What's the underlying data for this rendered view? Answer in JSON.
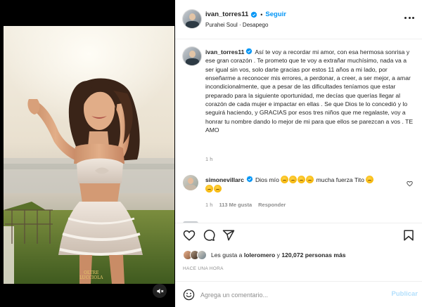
{
  "post": {
    "username": "ivan_torres11",
    "follow_label": "Seguir",
    "audio": "Purahei Soul · Desapego",
    "caption": "Así te voy a recordar mi amor, con esa hermosa sonrisa y ese gran corazón . Te prometo que te voy a extrañar muchísimo, nada va a ser igual sin vos, solo darte gracias por estos 11 años a mi lado, por enseñarme a reconocer mis errores, a perdonar, a creer, a ser mejor, a amar incondicionalmente, que a pesar de las dificultades teníamos que estar preparado para la siguiente oportunidad, me decías que querías llegar al corazón de cada mujer e impactar en ellas . Se que Dios te lo concedió y lo seguirá haciendo, y GRACIAS por esos tres niños que me regalaste, voy a honrar tu nombre dando lo mejor de mi para que ellos se parezcan a vos . TE AMO",
    "caption_time": "1 h"
  },
  "comments": [
    {
      "username": "simonevillarc",
      "text_before": "Dios mío",
      "text_after": "mucha fuerza Tito",
      "time": "1 h",
      "likes": "113 Me gusta",
      "reply_label": "Responder"
    }
  ],
  "likes": {
    "prefix": "Les gusta a",
    "user": "loleromero",
    "connector": "y",
    "others": "120,072 personas más"
  },
  "date": "HACE UNA HORA",
  "composer": {
    "placeholder": "Agrega un comentario...",
    "post_label": "Publicar"
  },
  "media": {
    "watermark_line1": "OLTRE",
    "watermark_line2": "LUCCIOLA"
  },
  "colors": {
    "accent": "#0095f6",
    "verified": "#0095f6",
    "post_disabled": "#b2dffc",
    "muted_text": "#8e8e8e"
  },
  "icons": {
    "verified": "verified-badge-icon",
    "more": "more-options-icon",
    "mute": "muted-speaker-icon",
    "like": "heart-icon",
    "comment": "comment-bubble-icon",
    "share": "paper-plane-icon",
    "save": "bookmark-icon",
    "emoji": "smiley-face-icon"
  }
}
